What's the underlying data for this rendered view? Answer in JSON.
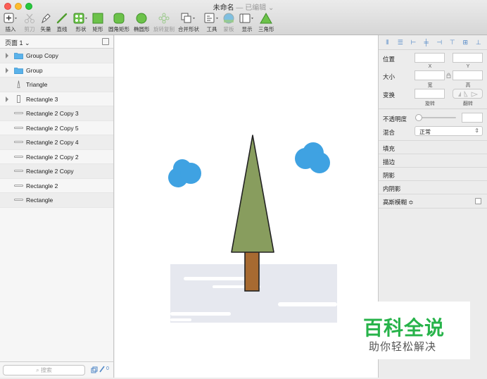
{
  "window": {
    "title": "未命名",
    "subtitle": "— 已编辑 ⌄"
  },
  "toolbar": {
    "insert": "插入",
    "scissors": "剪刀",
    "vector": "矢量",
    "line": "直线",
    "shape": "形状",
    "rect": "矩形",
    "rounded_rect": "圆角矩形",
    "oval": "椭圆形",
    "rotate_copy": "旋转复制",
    "combine": "合并形状",
    "tools": "工具",
    "mask": "蒙板",
    "display": "显示",
    "triangle": "三角形"
  },
  "layers_panel": {
    "page_label": "页面 1 ⌄",
    "search_placeholder": "搜索",
    "footer_count": "0",
    "layers": [
      {
        "name": "Group Copy",
        "type": "folder",
        "expandable": true
      },
      {
        "name": "Group",
        "type": "folder",
        "expandable": true
      },
      {
        "name": "Triangle",
        "type": "triangle",
        "expandable": false
      },
      {
        "name": "Rectangle 3",
        "type": "rect",
        "expandable": true
      },
      {
        "name": "Rectangle 2 Copy 3",
        "type": "line",
        "expandable": false
      },
      {
        "name": "Rectangle 2 Copy 5",
        "type": "line",
        "expandable": false
      },
      {
        "name": "Rectangle 2 Copy 4",
        "type": "line",
        "expandable": false
      },
      {
        "name": "Rectangle 2 Copy 2",
        "type": "line",
        "expandable": false
      },
      {
        "name": "Rectangle 2 Copy",
        "type": "line",
        "expandable": false
      },
      {
        "name": "Rectangle 2",
        "type": "line",
        "expandable": false
      },
      {
        "name": "Rectangle",
        "type": "line",
        "expandable": false
      }
    ]
  },
  "inspector": {
    "position": "位置",
    "x": "X",
    "y": "Y",
    "size": "大小",
    "width": "宽",
    "height": "高",
    "transform": "变换",
    "rotate": "旋转",
    "flip": "翻转",
    "opacity": "不透明度",
    "blend": "混合",
    "blend_value": "正常",
    "fill": "填充",
    "border": "描边",
    "shadow": "阴影",
    "inner_shadow": "内阴影",
    "blur": "高斯模糊 ≎"
  },
  "colors": {
    "cloud": "#3fa2e2",
    "tree": "#889d5e",
    "trunk": "#a76a31",
    "ground": "#e6e8ef",
    "brand": "#27b34a"
  },
  "watermark": {
    "title": "百科全说",
    "subtitle": "助你轻松解决"
  }
}
